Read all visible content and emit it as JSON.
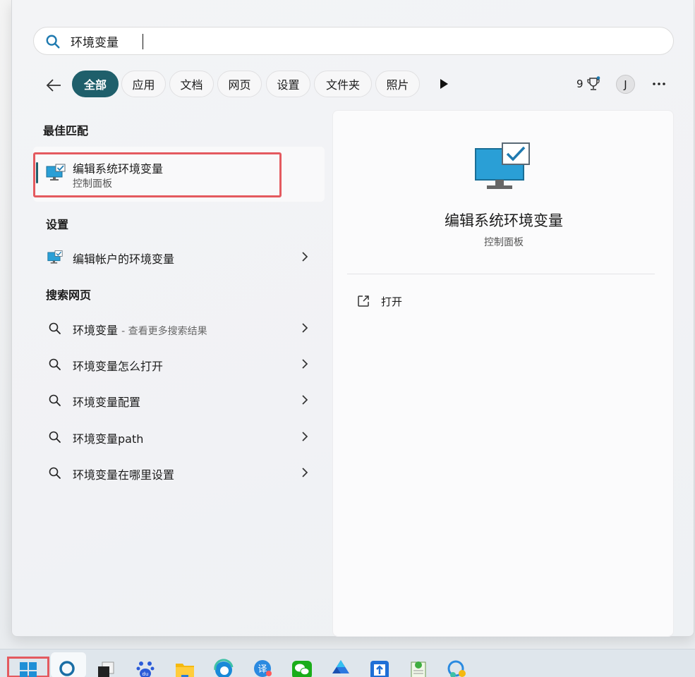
{
  "search": {
    "query": "环境变量",
    "placeholder": ""
  },
  "filters": {
    "tabs": [
      {
        "label": "全部",
        "active": true
      },
      {
        "label": "应用"
      },
      {
        "label": "文档"
      },
      {
        "label": "网页"
      },
      {
        "label": "设置"
      },
      {
        "label": "文件夹"
      },
      {
        "label": "照片"
      }
    ],
    "points": "9",
    "avatar_initial": "J"
  },
  "best_match": {
    "section_title": "最佳匹配",
    "name": "编辑系统环境变量",
    "subtitle": "控制面板"
  },
  "settings": {
    "section_title": "设置",
    "items": [
      {
        "label": "编辑帐户的环境变量"
      }
    ]
  },
  "web": {
    "section_title": "搜索网页",
    "items": [
      {
        "label": "环境变量",
        "suffix": "- 查看更多搜索结果"
      },
      {
        "label": "环境变量怎么打开"
      },
      {
        "label": "环境变量配置"
      },
      {
        "label": "环境变量path"
      },
      {
        "label": "环境变量在哪里设置"
      }
    ]
  },
  "detail": {
    "name": "编辑系统环境变量",
    "subtitle": "控制面板",
    "action_open": "打开"
  },
  "taskbar": {
    "icons": [
      "start-icon",
      "search-icon",
      "task-view-icon",
      "baidu-netdisk-icon",
      "file-explorer-icon",
      "edge-icon",
      "translate-icon",
      "wechat-icon",
      "drive-icon",
      "upload-app-icon",
      "notepad-icon",
      "chat-app-icon"
    ],
    "baidu_label": "du",
    "translate_label": "译"
  },
  "colors": {
    "accent": "#1f5f6b",
    "highlight": "#e45a5f"
  }
}
